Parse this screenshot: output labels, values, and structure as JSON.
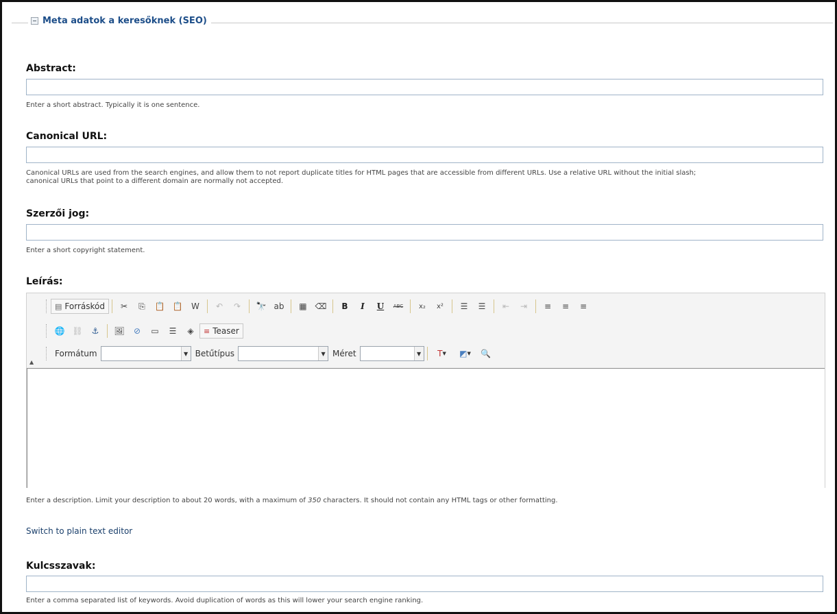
{
  "fieldset": {
    "legend": "Meta adatok a keresőknek (SEO)"
  },
  "abstract": {
    "label": "Abstract:",
    "value": "",
    "help": "Enter a short abstract. Typically it is one sentence."
  },
  "canonical": {
    "label": "Canonical URL:",
    "value": "",
    "help_line1": "Canonical URLs are used from the search engines, and allow them to not report duplicate titles for HTML pages that are accessible from different URLs. Use a relative URL without the initial slash;",
    "help_line2": "canonical URLs that point to a different domain are normally not accepted."
  },
  "copyright": {
    "label": "Szerzői jog:",
    "value": "",
    "help": "Enter a short copyright statement."
  },
  "description": {
    "label": "Leírás:",
    "help_before": "Enter a description. Limit your description to about 20 words, with a maximum of ",
    "help_max": "350",
    "help_after": " characters. It should not contain any HTML tags or other formatting."
  },
  "editor": {
    "source_button": "Forráskód",
    "teaser_button": "Teaser",
    "format_label": "Formátum",
    "font_label": "Betűtípus",
    "size_label": "Méret",
    "format_value": "",
    "font_value": "",
    "size_value": "",
    "icons": {
      "cut": "✂",
      "copy": "⎘",
      "paste": "📋",
      "paste_text": "📋",
      "paste_word": "W",
      "undo": "↶",
      "redo": "↷",
      "find": "🔭",
      "replace": "ab",
      "select_all": "▦",
      "remove_format": "⌫",
      "bold": "B",
      "italic": "I",
      "underline": "U",
      "strike": "ABC",
      "subscript": "x₂",
      "superscript": "x²",
      "numbered_list": "☰",
      "bulleted_list": "☰",
      "outdent": "⇤",
      "indent": "⇥",
      "align_left": "≡",
      "align_center": "≡",
      "align_right": "≡",
      "link": "🌐",
      "unlink": "⛓",
      "anchor": "⚓",
      "image": "🖼",
      "flash": "⊘",
      "table": "▭",
      "hr": "☰",
      "special": "◈",
      "text_color": "T",
      "bg_color": "◩",
      "preview": "🔍"
    }
  },
  "plain_text_link": "Switch to plain text editor",
  "keywords": {
    "label": "Kulcsszavak:",
    "value": "",
    "help": "Enter a comma separated list of keywords. Avoid duplication of words as this will lower your search engine ranking."
  }
}
